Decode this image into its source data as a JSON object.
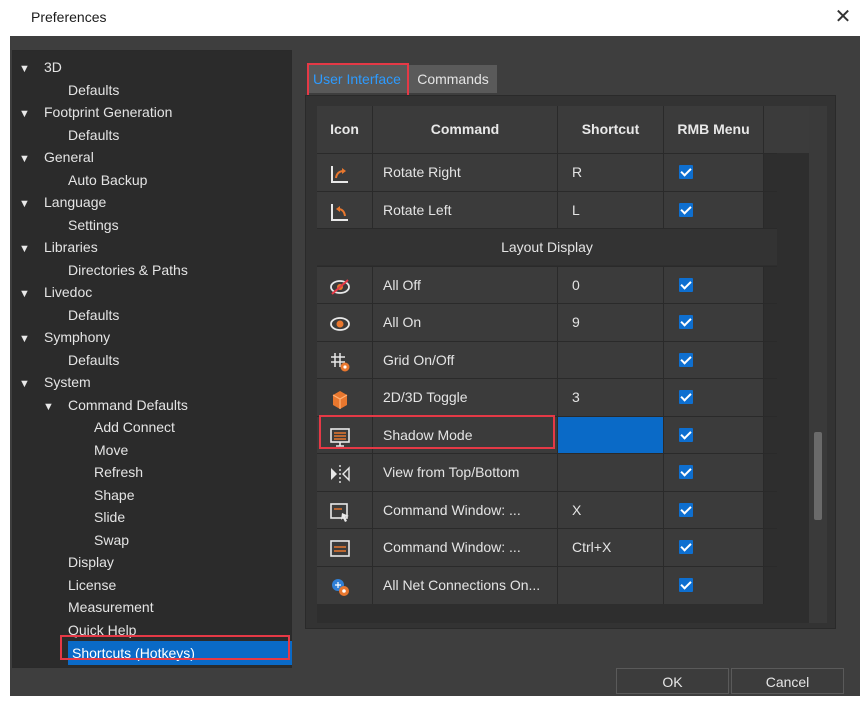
{
  "window": {
    "title": "Preferences",
    "close_glyph": "✕"
  },
  "tree": [
    {
      "label": "3D",
      "level": 0,
      "expanded": true
    },
    {
      "label": "Defaults",
      "level": 1
    },
    {
      "label": "Footprint Generation",
      "level": 0,
      "expanded": true
    },
    {
      "label": "Defaults",
      "level": 1
    },
    {
      "label": "General",
      "level": 0,
      "expanded": true
    },
    {
      "label": "Auto Backup",
      "level": 1
    },
    {
      "label": "Language",
      "level": 0,
      "expanded": true
    },
    {
      "label": "Settings",
      "level": 1
    },
    {
      "label": "Libraries",
      "level": 0,
      "expanded": true
    },
    {
      "label": "Directories & Paths",
      "level": 1
    },
    {
      "label": "Livedoc",
      "level": 0,
      "expanded": true
    },
    {
      "label": "Defaults",
      "level": 1
    },
    {
      "label": "Symphony",
      "level": 0,
      "expanded": true
    },
    {
      "label": "Defaults",
      "level": 1
    },
    {
      "label": "System",
      "level": 0,
      "expanded": true
    },
    {
      "label": "Command Defaults",
      "level": 1,
      "expanded": true
    },
    {
      "label": "Add Connect",
      "level": 2
    },
    {
      "label": "Move",
      "level": 2
    },
    {
      "label": "Refresh",
      "level": 2
    },
    {
      "label": "Shape",
      "level": 2
    },
    {
      "label": "Slide",
      "level": 2
    },
    {
      "label": "Swap",
      "level": 2
    },
    {
      "label": "Display",
      "level": 1
    },
    {
      "label": "License",
      "level": 1
    },
    {
      "label": "Measurement",
      "level": 1
    },
    {
      "label": "Quick Help",
      "level": 1
    },
    {
      "label": "Shortcuts (Hotkeys)",
      "level": 1,
      "selected": true
    }
  ],
  "tabs": {
    "active": "User Interface",
    "inactive": "Commands"
  },
  "table": {
    "headers": {
      "icon": "Icon",
      "command": "Command",
      "shortcut": "Shortcut",
      "rmb": "RMB Menu"
    },
    "group_label": "Layout Display",
    "rows_before_group": [
      {
        "icon": "rotate-right-icon",
        "command": "Rotate Right",
        "shortcut": "R",
        "rmb": true
      },
      {
        "icon": "rotate-left-icon",
        "command": "Rotate Left",
        "shortcut": "L",
        "rmb": true
      }
    ],
    "rows_after_group": [
      {
        "icon": "eye-off-icon",
        "command": "All Off",
        "shortcut": "0",
        "rmb": true
      },
      {
        "icon": "eye-icon",
        "command": "All On",
        "shortcut": "9",
        "rmb": true
      },
      {
        "icon": "grid-icon",
        "command": "Grid On/Off",
        "shortcut": "",
        "rmb": true
      },
      {
        "icon": "cube-icon",
        "command": "2D/3D Toggle",
        "shortcut": "3",
        "rmb": true
      },
      {
        "icon": "shadow-mode-icon",
        "command": "Shadow Mode",
        "shortcut": "",
        "rmb": true,
        "selected": true
      },
      {
        "icon": "flip-view-icon",
        "command": "View from Top/Bottom",
        "shortcut": "",
        "rmb": true
      },
      {
        "icon": "command-window-icon",
        "command": "Command Window: ...",
        "shortcut": "X",
        "rmb": true
      },
      {
        "icon": "command-window-2-icon",
        "command": "Command Window: ...",
        "shortcut": "Ctrl+X",
        "rmb": true
      },
      {
        "icon": "net-connections-icon",
        "command": "All Net Connections On...",
        "shortcut": "",
        "rmb": true
      }
    ]
  },
  "buttons": {
    "ok": "OK",
    "cancel": "Cancel"
  },
  "colors": {
    "accent": "#0a6ac7",
    "highlight": "#e53946",
    "panel": "#3e3e3e"
  }
}
